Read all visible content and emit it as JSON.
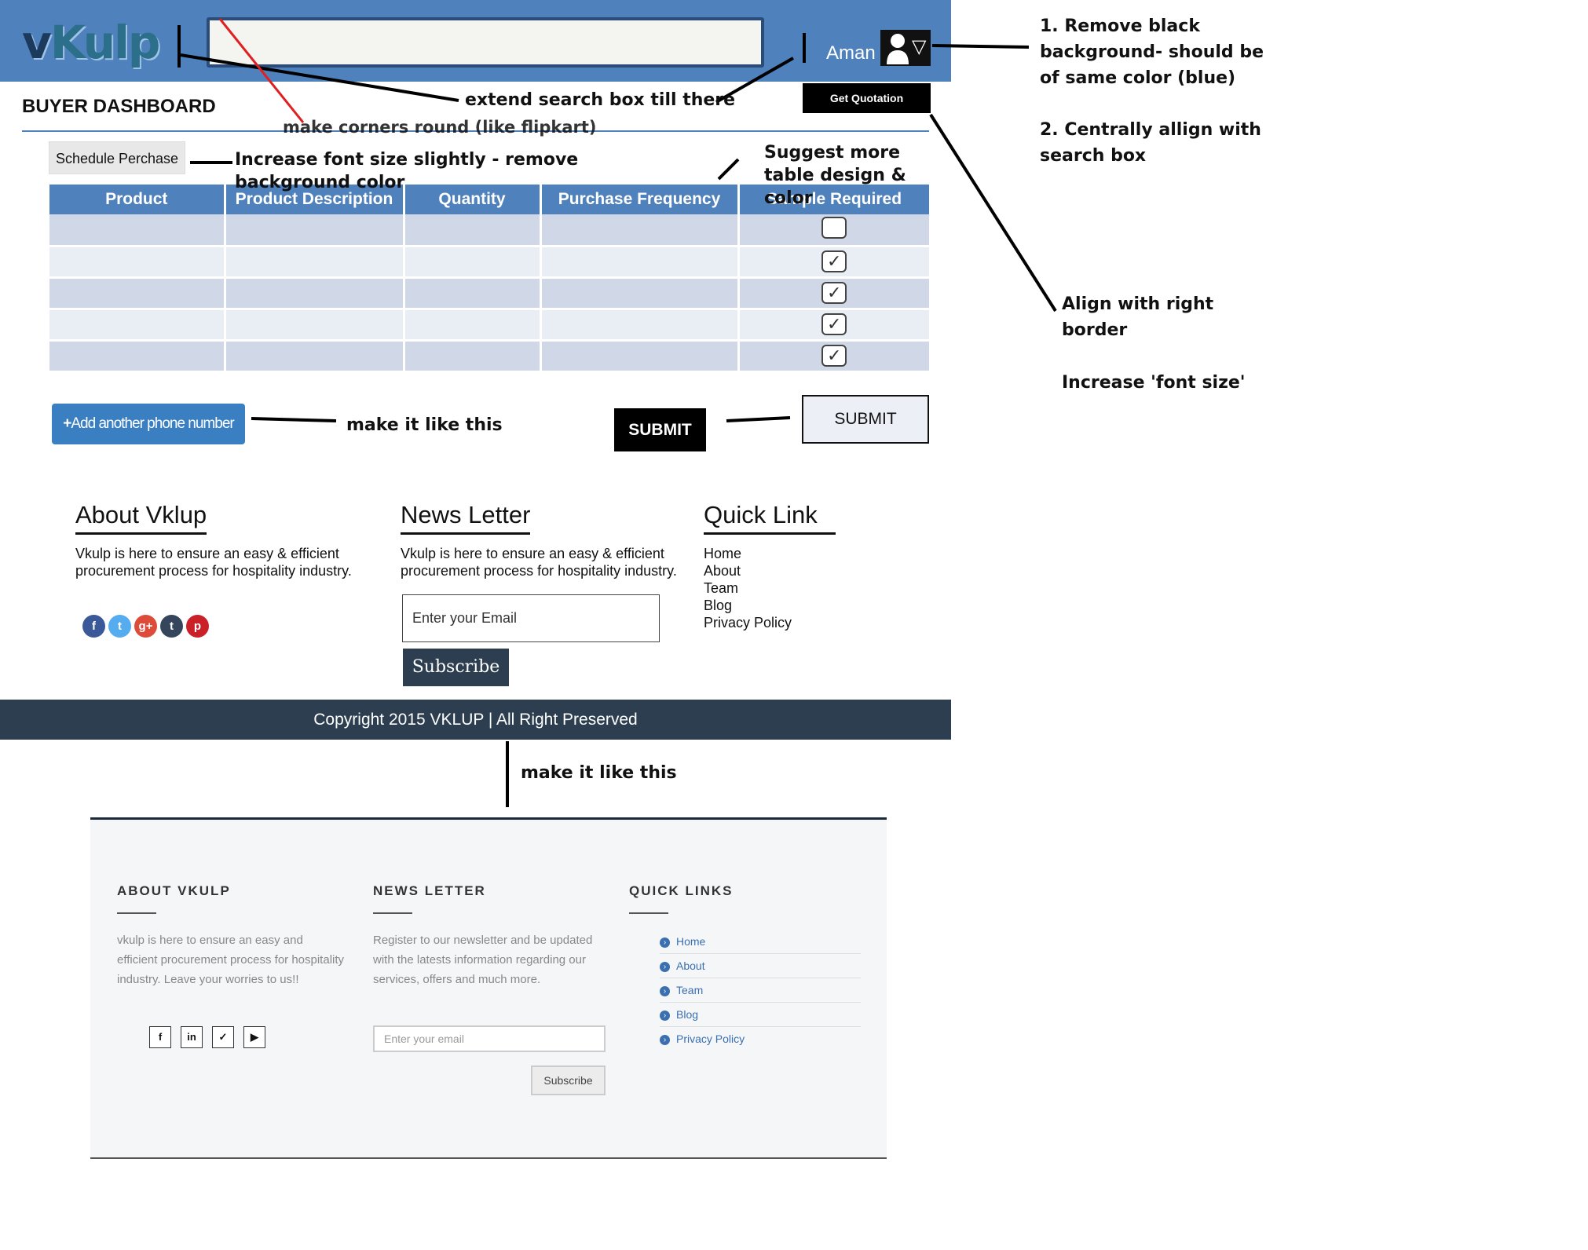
{
  "header": {
    "logo_v": "v",
    "logo_rest": "Kulp",
    "search_placeholder": "",
    "user_name": "Aman",
    "dropdown_glyph": "▽",
    "get_quotation": "Get Quotation"
  },
  "dashboard": {
    "title": "BUYER DASHBOARD",
    "schedule_button": "Schedule Perchase",
    "table": {
      "headers": [
        "Product",
        "Product Description",
        "Quantity",
        "Purchase Frequency",
        "Sample Required"
      ],
      "sample_checked": [
        false,
        true,
        true,
        true,
        true
      ]
    },
    "add_phone_button": "Add another phone number",
    "submit_dark": "SUBMIT",
    "submit_light": "SUBMIT"
  },
  "footer_current": {
    "about_title": "About Vklup",
    "about_text": "Vkulp is here to ensure an easy & efficient procurement process for hospitality industry.",
    "newsletter_title": "News Letter",
    "newsletter_text": "Vkulp is here to ensure an easy & efficient procurement process for hospitality industry.",
    "email_placeholder": "Enter your Email",
    "subscribe": "Subscribe",
    "quick_title": "Quick Link",
    "links": [
      "Home",
      "About",
      "Team",
      "Blog",
      "Privacy Policy"
    ],
    "social_icons": [
      "facebook-icon",
      "twitter-icon",
      "google-plus-icon",
      "tumblr-icon",
      "pinterest-icon"
    ],
    "social_glyphs": [
      "f",
      "t",
      "g+",
      "t",
      "p"
    ],
    "social_colors": [
      "#3b5998",
      "#55acee",
      "#dd4b39",
      "#35465c",
      "#cb2027"
    ],
    "copyright": "Copyright 2015 VKLUP | All Right Preserved"
  },
  "footer_proposed": {
    "about_title": "ABOUT VKULP",
    "about_text": "vkulp is here to ensure an easy and efficient procurement process for hospitality industry. Leave your worries to us!!",
    "newsletter_title": "NEWS LETTER",
    "newsletter_text": "Register to our newsletter and be updated with the latests information regarding our services, offers and much more.",
    "email_placeholder": "Enter your email",
    "subscribe": "Subscribe",
    "quick_title": "QUICK LINKS",
    "links": [
      "Home",
      "About",
      "Team",
      "Blog",
      "Privacy Policy"
    ],
    "social_glyphs": [
      "f",
      "in",
      "✓",
      "▶"
    ]
  },
  "annotations": {
    "search_extend": "extend search box till there",
    "corners": "make corners round (like flipkart)",
    "schedule_font": "Increase font size slightly - remove background color",
    "table_design": "Suggest more table design & color",
    "user_bg": "1. Remove black background- should be of same color (blue)",
    "center_align": "2. Centrally allign with search box",
    "align_right": "Align with right border",
    "font_size": "Increase 'font size'",
    "make_like_1": "make it like this",
    "make_like_2": "make it like this"
  },
  "colors": {
    "header_blue": "#4f81bd",
    "footer_navy": "#2c3e50",
    "table_row_a": "#d0d8e8",
    "table_row_b": "#e9edf4"
  }
}
